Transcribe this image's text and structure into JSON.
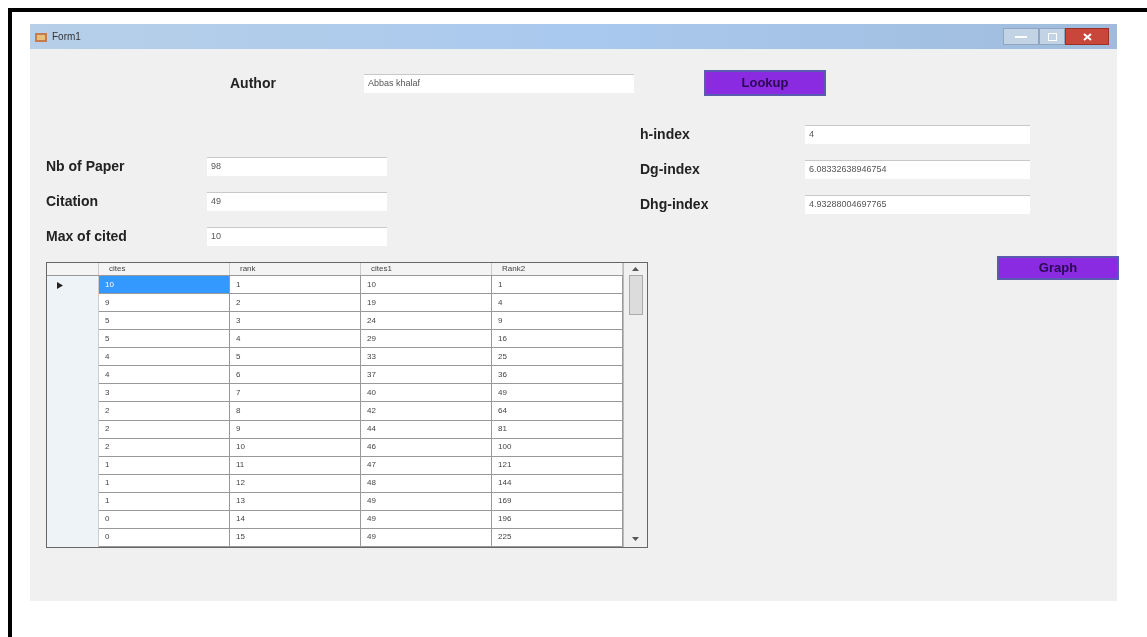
{
  "window": {
    "title": "Form1"
  },
  "author": {
    "label": "Author",
    "value": "Abbas khalaf"
  },
  "lookup_button": "Lookup",
  "left_fields": [
    {
      "label": "Nb of Paper",
      "value": "98"
    },
    {
      "label": "Citation",
      "value": "49"
    },
    {
      "label": "Max of cited",
      "value": "10"
    }
  ],
  "right_fields": [
    {
      "label": "h-index",
      "value": "4"
    },
    {
      "label": "Dg-index",
      "value": "6.08332638946754"
    },
    {
      "label": "Dhg-index",
      "value": "4.93288004697765"
    }
  ],
  "graph_button": "Graph",
  "table": {
    "columns": [
      "cites",
      "rank",
      "cites1",
      "Rank2"
    ],
    "rows": [
      {
        "current": true,
        "cells": [
          {
            "text": "10",
            "selected": true
          },
          {
            "text": "1",
            "selected": false
          },
          {
            "text": "10",
            "selected": false
          },
          {
            "text": "1",
            "selected": false
          }
        ]
      },
      {
        "current": false,
        "cells": [
          {
            "text": "9",
            "selected": false
          },
          {
            "text": "2",
            "selected": false
          },
          {
            "text": "19",
            "selected": false
          },
          {
            "text": "4",
            "selected": false
          }
        ]
      },
      {
        "current": false,
        "cells": [
          {
            "text": "5",
            "selected": false
          },
          {
            "text": "3",
            "selected": false
          },
          {
            "text": "24",
            "selected": false
          },
          {
            "text": "9",
            "selected": false
          }
        ]
      },
      {
        "current": false,
        "cells": [
          {
            "text": "5",
            "selected": false
          },
          {
            "text": "4",
            "selected": false
          },
          {
            "text": "29",
            "selected": false
          },
          {
            "text": "16",
            "selected": false
          }
        ]
      },
      {
        "current": false,
        "cells": [
          {
            "text": "4",
            "selected": false
          },
          {
            "text": "5",
            "selected": false
          },
          {
            "text": "33",
            "selected": false
          },
          {
            "text": "25",
            "selected": false
          }
        ]
      },
      {
        "current": false,
        "cells": [
          {
            "text": "4",
            "selected": false
          },
          {
            "text": "6",
            "selected": false
          },
          {
            "text": "37",
            "selected": false
          },
          {
            "text": "36",
            "selected": false
          }
        ]
      },
      {
        "current": false,
        "cells": [
          {
            "text": "3",
            "selected": false
          },
          {
            "text": "7",
            "selected": false
          },
          {
            "text": "40",
            "selected": false
          },
          {
            "text": "49",
            "selected": false
          }
        ]
      },
      {
        "current": false,
        "cells": [
          {
            "text": "2",
            "selected": false
          },
          {
            "text": "8",
            "selected": false
          },
          {
            "text": "42",
            "selected": false
          },
          {
            "text": "64",
            "selected": false
          }
        ]
      },
      {
        "current": false,
        "cells": [
          {
            "text": "2",
            "selected": false
          },
          {
            "text": "9",
            "selected": false
          },
          {
            "text": "44",
            "selected": false
          },
          {
            "text": "81",
            "selected": false
          }
        ]
      },
      {
        "current": false,
        "cells": [
          {
            "text": "2",
            "selected": false
          },
          {
            "text": "10",
            "selected": false
          },
          {
            "text": "46",
            "selected": false
          },
          {
            "text": "100",
            "selected": false
          }
        ]
      },
      {
        "current": false,
        "cells": [
          {
            "text": "1",
            "selected": false
          },
          {
            "text": "11",
            "selected": false
          },
          {
            "text": "47",
            "selected": false
          },
          {
            "text": "121",
            "selected": false
          }
        ]
      },
      {
        "current": false,
        "cells": [
          {
            "text": "1",
            "selected": false
          },
          {
            "text": "12",
            "selected": false
          },
          {
            "text": "48",
            "selected": false
          },
          {
            "text": "144",
            "selected": false
          }
        ]
      },
      {
        "current": false,
        "cells": [
          {
            "text": "1",
            "selected": false
          },
          {
            "text": "13",
            "selected": false
          },
          {
            "text": "49",
            "selected": false
          },
          {
            "text": "169",
            "selected": false
          }
        ]
      },
      {
        "current": false,
        "cells": [
          {
            "text": "0",
            "selected": false
          },
          {
            "text": "14",
            "selected": false
          },
          {
            "text": "49",
            "selected": false
          },
          {
            "text": "196",
            "selected": false
          }
        ]
      },
      {
        "current": false,
        "cells": [
          {
            "text": "0",
            "selected": false
          },
          {
            "text": "15",
            "selected": false
          },
          {
            "text": "49",
            "selected": false
          },
          {
            "text": "225",
            "selected": false
          }
        ]
      }
    ]
  }
}
